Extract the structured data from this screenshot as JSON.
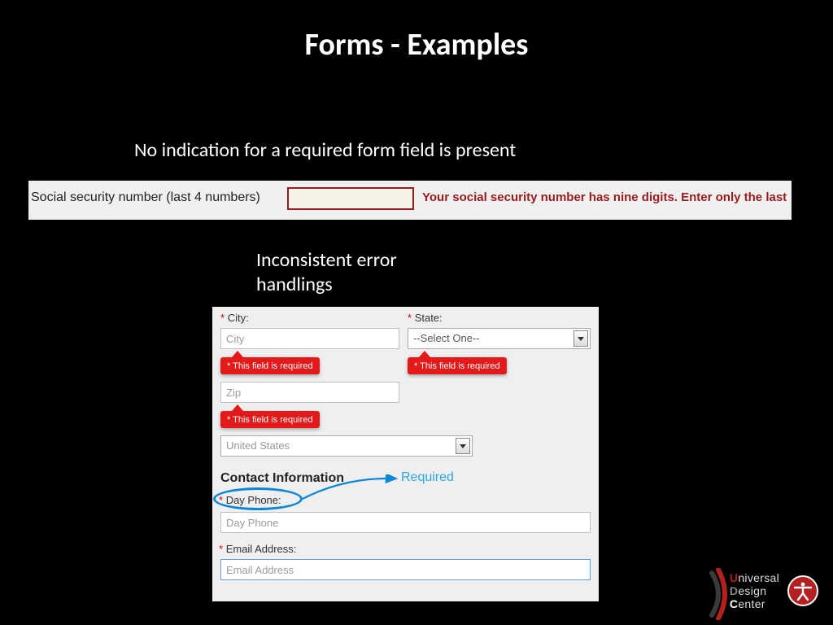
{
  "title": "Forms - Examples",
  "caption1": "No indication for a required form field is present",
  "caption2": "Inconsistent error handlings",
  "example1": {
    "label": "Social security number (last 4 numbers)",
    "message": "Your social security number has nine digits. Enter only the last"
  },
  "example2": {
    "city_label": "City:",
    "city_placeholder": "City",
    "state_label": "State:",
    "state_selected": "--Select One--",
    "zip_placeholder": "Zip",
    "country_value": "United States",
    "error_required": "* This field is required",
    "section_heading": "Contact Information",
    "required_annotation": "Required",
    "day_phone_label": "Day Phone:",
    "day_phone_placeholder": "Day Phone",
    "email_label": "Email Address:",
    "email_placeholder": "Email Address",
    "star": "*"
  },
  "logo": {
    "u": "U",
    "u_rest": "niversal",
    "d": "D",
    "d_rest": "esign",
    "c": "C",
    "c_rest": "enter"
  }
}
